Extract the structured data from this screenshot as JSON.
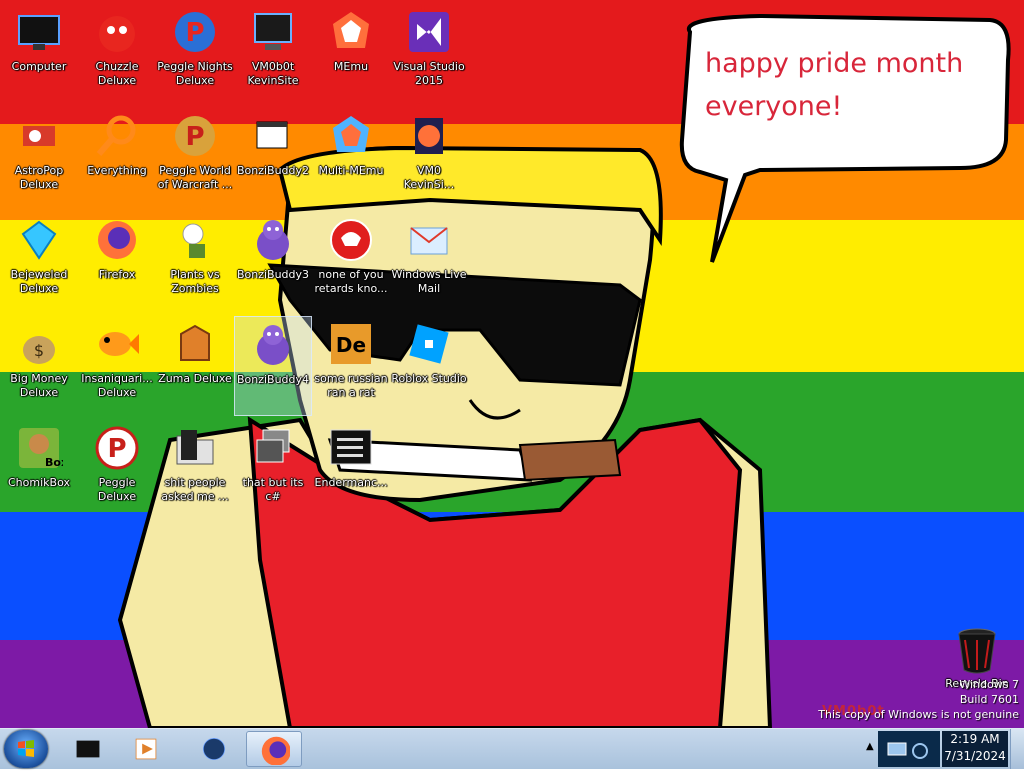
{
  "wallpaper": {
    "speech_text": "happy pride month everyone!",
    "stripe_colors": [
      "#e41a1c",
      "#ff8a00",
      "#ffed00",
      "#2aa52b",
      "#0a4fff",
      "#7d1aa6"
    ]
  },
  "desktop_icons": [
    {
      "label": "Computer",
      "icon": "computer-icon"
    },
    {
      "label": "Chuzzle Deluxe",
      "icon": "chuzzle-icon"
    },
    {
      "label": "Peggle Nights Deluxe",
      "icon": "peggle-nights-icon"
    },
    {
      "label": "VM0b0t KevinSite",
      "icon": "monitor-shortcut-icon"
    },
    {
      "label": "MEmu",
      "icon": "memu-icon"
    },
    {
      "label": "Visual Studio 2015",
      "icon": "visual-studio-icon"
    },
    {
      "label": "AstroPop Deluxe",
      "icon": "astropop-icon"
    },
    {
      "label": "Everything",
      "icon": "everything-search-icon"
    },
    {
      "label": "Peggle World of Warcraft ...",
      "icon": "peggle-wow-icon"
    },
    {
      "label": "BonziBuddy2",
      "icon": "window-shortcut-icon"
    },
    {
      "label": "Multi-MEmu",
      "icon": "multi-memu-icon"
    },
    {
      "label": "VM0 KevinSi...",
      "icon": "firefox-shortcut-icon"
    },
    {
      "label": "Bejeweled Deluxe",
      "icon": "bejeweled-icon"
    },
    {
      "label": "Firefox",
      "icon": "firefox-icon"
    },
    {
      "label": "Plants vs Zombies",
      "icon": "plants-vs-zombies-icon"
    },
    {
      "label": "BonziBuddy3",
      "icon": "bonzi-icon"
    },
    {
      "label": "none of you retards kno...",
      "icon": "red-circle-icon"
    },
    {
      "label": "Windows Live Mail",
      "icon": "windows-live-mail-icon"
    },
    {
      "label": "Big Money Deluxe",
      "icon": "money-bag-icon"
    },
    {
      "label": "Insaniquari... Deluxe",
      "icon": "goldfish-icon"
    },
    {
      "label": "Zuma Deluxe",
      "icon": "zuma-icon"
    },
    {
      "label": "BonziBuddy4",
      "icon": "bonzi-icon"
    },
    {
      "label": "some russian ran a rat",
      "icon": "de-app-icon"
    },
    {
      "label": "Roblox Studio",
      "icon": "roblox-studio-icon"
    },
    {
      "label": "ChomikBox",
      "icon": "chomikbox-icon"
    },
    {
      "label": "Peggle Deluxe",
      "icon": "peggle-icon"
    },
    {
      "label": "shit people asked me ...",
      "icon": "folder-icon"
    },
    {
      "label": "that but its c#",
      "icon": "overlapped-windows-icon"
    },
    {
      "label": "Endermanc...",
      "icon": "console-window-icon"
    }
  ],
  "recycle_bin": {
    "label": "Recycle Bin"
  },
  "watermark": {
    "line1": "Windows 7",
    "line2": "Build 7601",
    "line3": "This copy of Windows is not genuine",
    "logo_text": "VM0b0t"
  },
  "taskbar": {
    "pinned": [
      {
        "icon": "black-box-app-icon"
      },
      {
        "icon": "media-player-icon"
      },
      {
        "icon": "globe-app-icon"
      },
      {
        "icon": "firefox-icon",
        "active": true
      }
    ],
    "clock_time": "2:19 AM",
    "clock_date": "7/31/2024"
  }
}
